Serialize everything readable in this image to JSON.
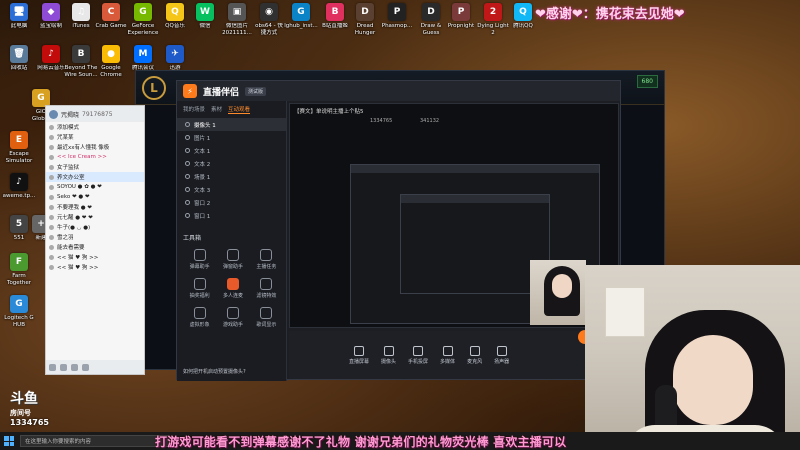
{
  "banner": "❤感谢❤：携花束去见她❤",
  "desktop_icons": [
    {
      "label": "此电脑",
      "glyph": "🖥",
      "color": "#2b6fd6"
    },
    {
      "label": "蓝宝绘制",
      "glyph": "◆",
      "color": "#8d4bd6"
    },
    {
      "label": "iTunes",
      "glyph": "♫",
      "color": "#e8e8e8"
    },
    {
      "label": "Crab Game",
      "glyph": "C",
      "color": "#d85a3a"
    },
    {
      "label": "GeForce\nExperience",
      "glyph": "G",
      "color": "#76b900"
    },
    {
      "label": "QQ音乐",
      "glyph": "Q",
      "color": "#f5c518"
    },
    {
      "label": "微信",
      "glyph": "W",
      "color": "#07c160"
    },
    {
      "label": "微信图片\n2021111...",
      "glyph": "▣",
      "color": "#555"
    },
    {
      "label": "obs64 - 快\n捷方式",
      "glyph": "◉",
      "color": "#303030"
    },
    {
      "label": "lghub_inst...",
      "glyph": "G",
      "color": "#0a84c7"
    },
    {
      "label": "B站直播姬",
      "glyph": "B",
      "color": "#e03060"
    },
    {
      "label": "Dread\nHunger",
      "glyph": "D",
      "color": "#5a4030"
    },
    {
      "label": "Phasmop...",
      "glyph": "P",
      "color": "#222"
    },
    {
      "label": "Draw &\nGuess",
      "glyph": "D",
      "color": "#2a2a2a"
    },
    {
      "label": "Propnight",
      "glyph": "P",
      "color": "#7a3a3a"
    },
    {
      "label": "Dying Light\n2",
      "glyph": "2",
      "color": "#c01818"
    },
    {
      "label": "腾讯QQ",
      "glyph": "Q",
      "color": "#12b7f5"
    },
    {
      "label": "回收站",
      "glyph": "🗑",
      "color": "#5a7a9a"
    },
    {
      "label": "网易云音乐",
      "glyph": "♪",
      "color": "#c20c0c"
    },
    {
      "label": "Beyond The\nWire Soun...",
      "glyph": "B",
      "color": "#3a3a3a"
    },
    {
      "label": "Google\nChrome",
      "glyph": "●",
      "color": "#fbbc05"
    },
    {
      "label": "腾讯会议",
      "glyph": "M",
      "color": "#006eff"
    },
    {
      "label": "迅游",
      "glyph": "✈",
      "color": "#1e5ac8"
    },
    {
      "label": "GIO\nGlob...",
      "glyph": "G",
      "color": "#d8a020"
    },
    {
      "label": "Escape\nSimulator",
      "glyph": "E",
      "color": "#e06010"
    },
    {
      "label": "aweme.tp...",
      "glyph": "♪",
      "color": "#111"
    },
    {
      "label": "551",
      "glyph": "5",
      "color": "#444"
    },
    {
      "label": "Farm\nTogether",
      "glyph": "F",
      "color": "#4a9a30"
    },
    {
      "label": "Logitech G\nHUB",
      "glyph": "G",
      "color": "#2a8ad8"
    },
    {
      "label": "新建",
      "glyph": "+",
      "color": "#666"
    }
  ],
  "qq": {
    "user": "咒揭晓",
    "id": "79176875",
    "rows": [
      {
        "text": "添加模式",
        "cls": ""
      },
      {
        "text": "咒某某",
        "cls": ""
      },
      {
        "text": "最近xx有人懂我 像极",
        "cls": ""
      },
      {
        "text": "<< Ice Cream >>",
        "cls": "pink"
      },
      {
        "text": "女子监狱",
        "cls": ""
      },
      {
        "text": "养文办公室",
        "cls": "hl"
      },
      {
        "text": "SOYOU ● ✿ ● ❤",
        "cls": ""
      },
      {
        "text": "Seko ❤ ● ❤",
        "cls": ""
      },
      {
        "text": "不要理我 ● ❤",
        "cls": ""
      },
      {
        "text": "元七醒 ● ❤ ❤",
        "cls": ""
      },
      {
        "text": "牛子(● ◡ ●)",
        "cls": ""
      },
      {
        "text": "雪之羽",
        "cls": ""
      },
      {
        "text": "能去看需要",
        "cls": ""
      },
      {
        "text": "<< 猫 ♥ 狗 >>",
        "cls": ""
      },
      {
        "text": "<< 猫 ♥ 狗 >>",
        "cls": ""
      }
    ]
  },
  "assistant": {
    "title": "直播伴侣",
    "version": "测试版",
    "tabs": [
      "我的场景",
      "素材",
      "互动观看"
    ],
    "scenes": [
      "摄像头 1",
      "图片 1",
      "文本 1",
      "文本 2",
      "场景 1",
      "文本 3",
      "窗口 2",
      "窗口 1"
    ],
    "tools_header": "工具箱",
    "tools": [
      "弹幕助手",
      "弹窗助手",
      "主播任务",
      "抽奖福利",
      "多人连麦",
      "滤镜特效",
      "虚拟形象",
      "游戏助手",
      "歌词显示"
    ],
    "notice": "如何把开机启动预置摄像头?",
    "preview_title": "【赛文】单说明主播上个贴5",
    "preview_stats": [
      "1334765",
      "341132"
    ],
    "bottom_buttons": [
      "直播屏幕",
      "摄像头",
      "手机投屏",
      "多媒体",
      "麦克风",
      "扬声器"
    ],
    "go_live": "开始直播"
  },
  "game": {
    "badge": "680"
  },
  "douyu": {
    "brand": "斗鱼",
    "label": "房间号",
    "room": "1334765"
  },
  "taskbar": {
    "search_placeholder": "在这里输入你要搜索的内容"
  },
  "subtitle": "打游戏可能看不到弹幕感谢不了礼物 谢谢兄弟们的礼物荧光棒 喜欢主播可以"
}
